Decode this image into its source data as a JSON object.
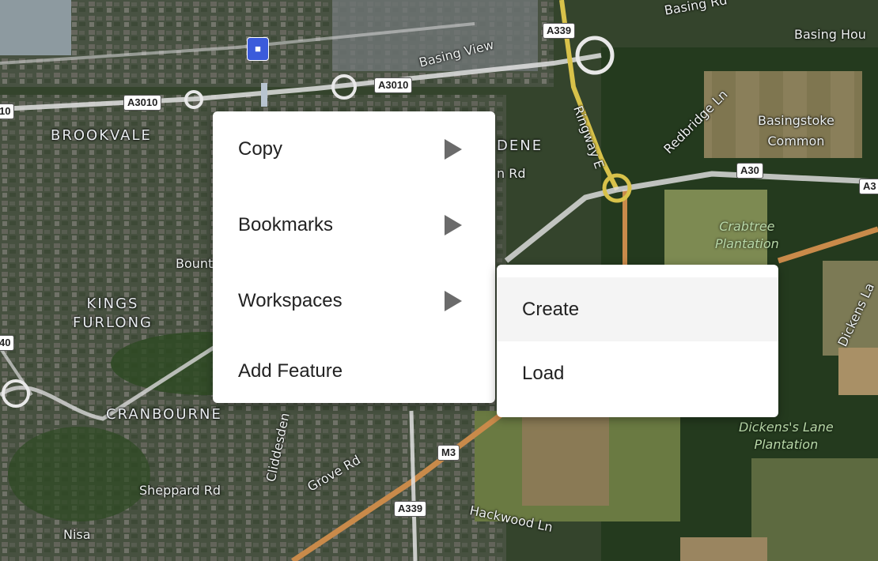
{
  "map": {
    "places": [
      {
        "id": "brookvale",
        "label": "BROOKVALE"
      },
      {
        "id": "kings-furlong",
        "label": "KINGS\nFURLONG"
      },
      {
        "id": "cranbourne",
        "label": "CRANBOURNE"
      },
      {
        "id": "dene",
        "label": "DENE"
      },
      {
        "id": "basing-house",
        "label": "Basing Hou"
      },
      {
        "id": "basingstoke-common",
        "label": "Basingstoke\nCommon"
      }
    ],
    "road_shields": [
      "A339",
      "A3010",
      "A3010",
      "10",
      "A30",
      "A3",
      "40",
      "M3",
      "A339"
    ],
    "streets": [
      "Basing Rd",
      "Basing View",
      "Ringway E",
      "Redbridge Ln",
      "n Rd",
      "Bount",
      "Cliddesden",
      "Grove Rd",
      "Sheppard Rd",
      "Nisa",
      "Hackwood Ln",
      "Dickens La"
    ],
    "green_areas": [
      "Crabtree\nPlantation",
      "Dickens's Lane\nPlantation"
    ]
  },
  "context_menu": {
    "items": [
      {
        "label": "Copy",
        "has_submenu": true
      },
      {
        "label": "Bookmarks",
        "has_submenu": true
      },
      {
        "label": "Workspaces",
        "has_submenu": true
      },
      {
        "label": "Add Feature",
        "has_submenu": false
      }
    ]
  },
  "submenu": {
    "items": [
      {
        "label": "Create",
        "highlighted": true
      },
      {
        "label": "Load",
        "highlighted": false
      }
    ]
  },
  "colors": {
    "menu_bg": "#ffffff",
    "hover_bg": "#f4f4f4",
    "arrow": "#6b6b6b",
    "motorway": "#c98a4a",
    "a_road": "#d8c24a"
  }
}
